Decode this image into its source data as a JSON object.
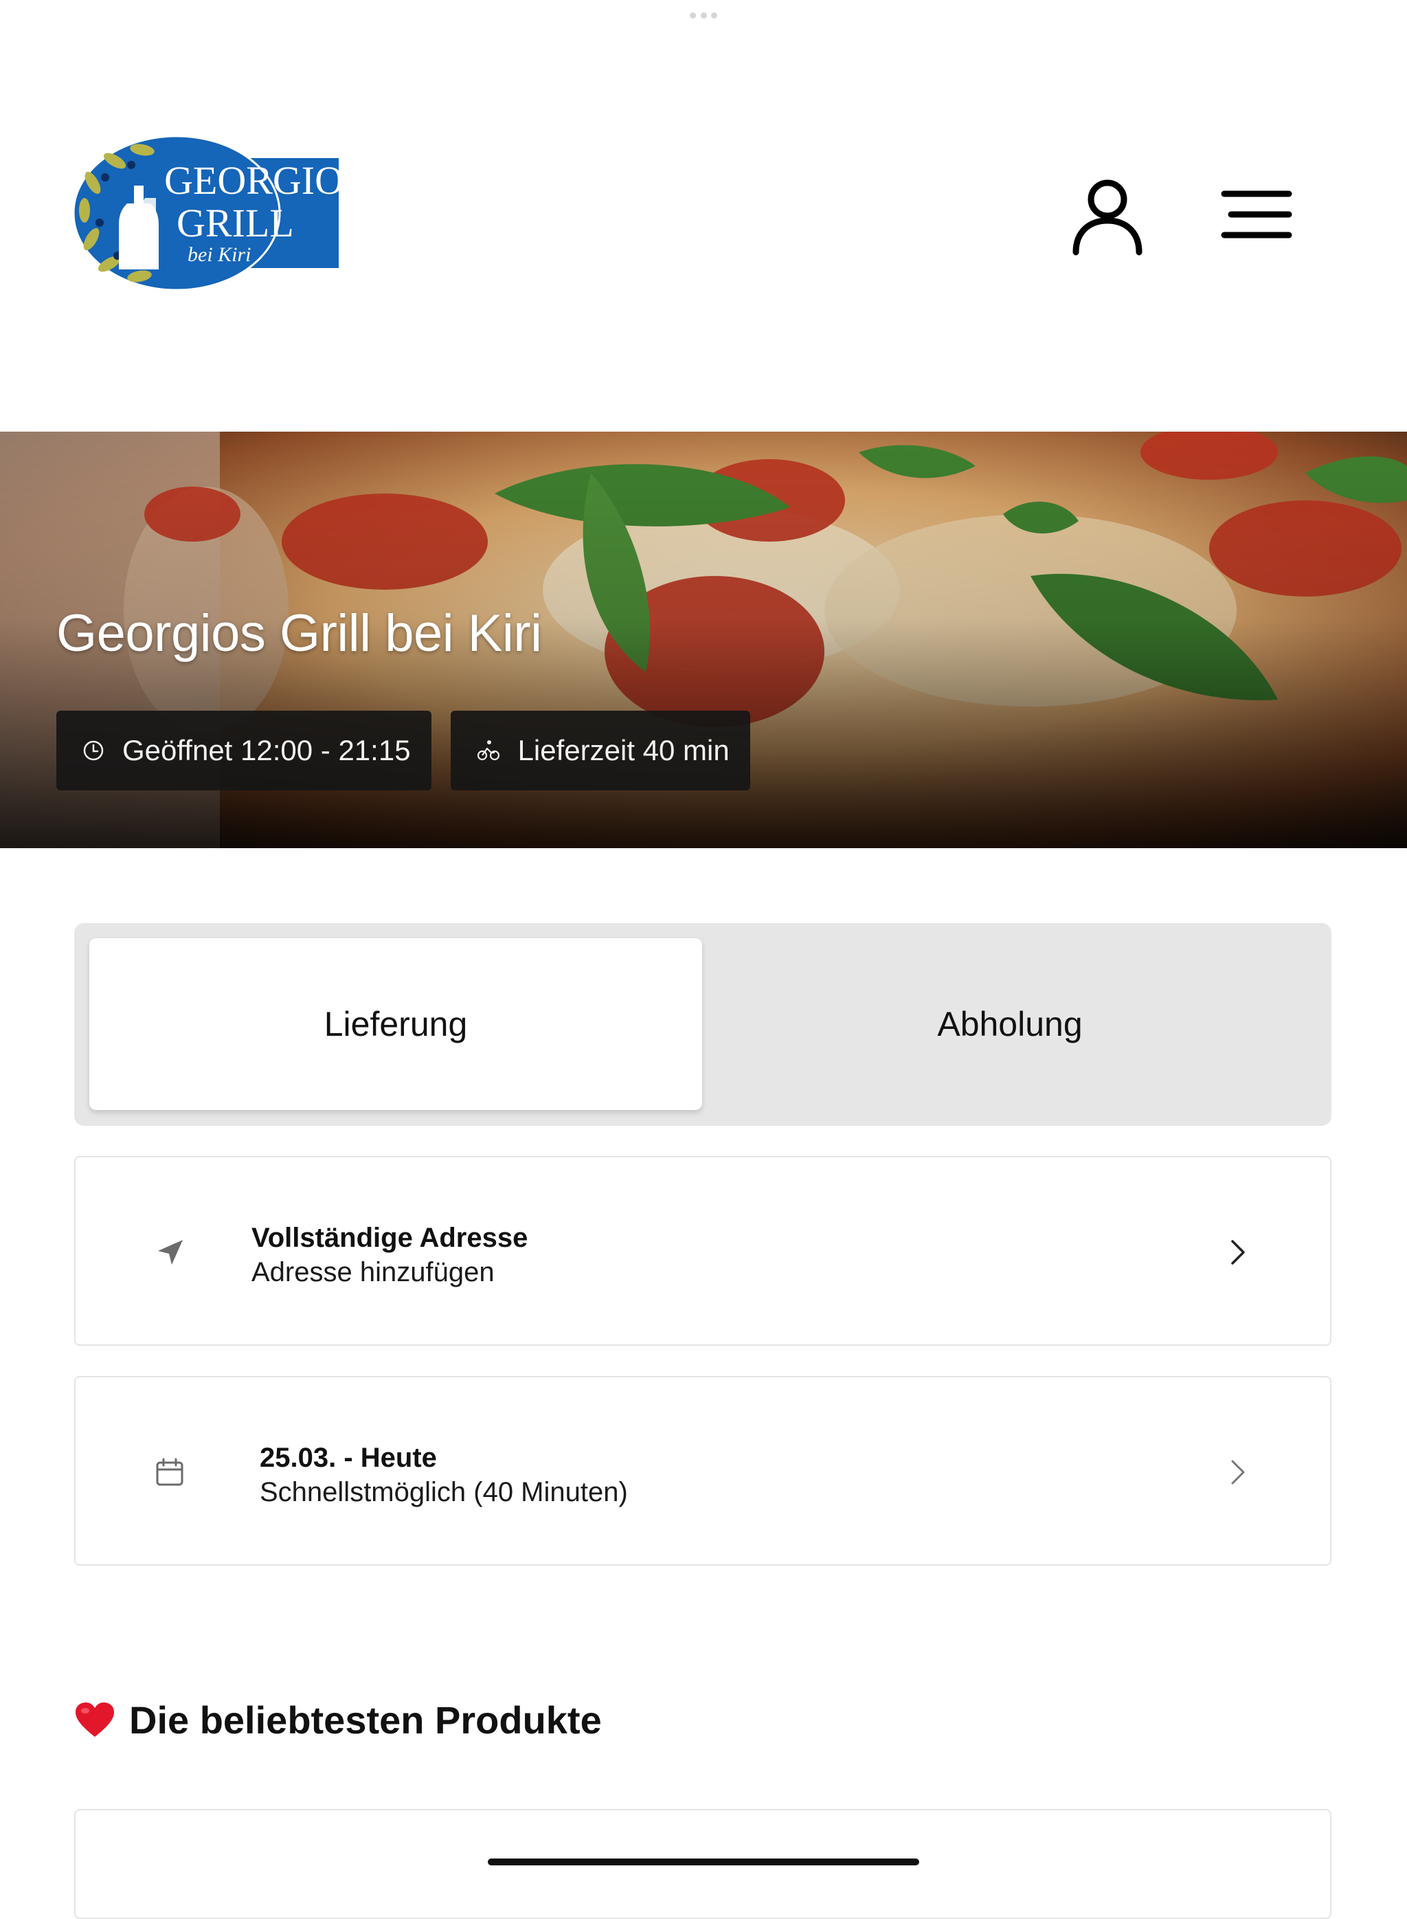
{
  "brand": {
    "logo_line1": "GEORGIOS",
    "logo_line2": "GRILL",
    "logo_line3": "bei Kiri"
  },
  "hero": {
    "title": "Georgios Grill bei Kiri",
    "open_hours": "Geöffnet 12:00 - 21:15",
    "delivery_time": "Lieferzeit 40 min"
  },
  "order_mode": {
    "delivery_label": "Lieferung",
    "pickup_label": "Abholung",
    "selected": "Lieferung"
  },
  "address_card": {
    "title": "Vollständige Adresse",
    "subtitle": "Adresse hinzufügen"
  },
  "time_card": {
    "title": "25.03. - Heute",
    "subtitle": "Schnellstmöglich (40 Minuten)"
  },
  "popular": {
    "title": "Die beliebtesten Produkte"
  },
  "colors": {
    "logo_blue": "#1565b8",
    "logo_leaf": "#b7b44a",
    "chip_bg": "#161616",
    "segment_bg": "#e6e6e6"
  }
}
